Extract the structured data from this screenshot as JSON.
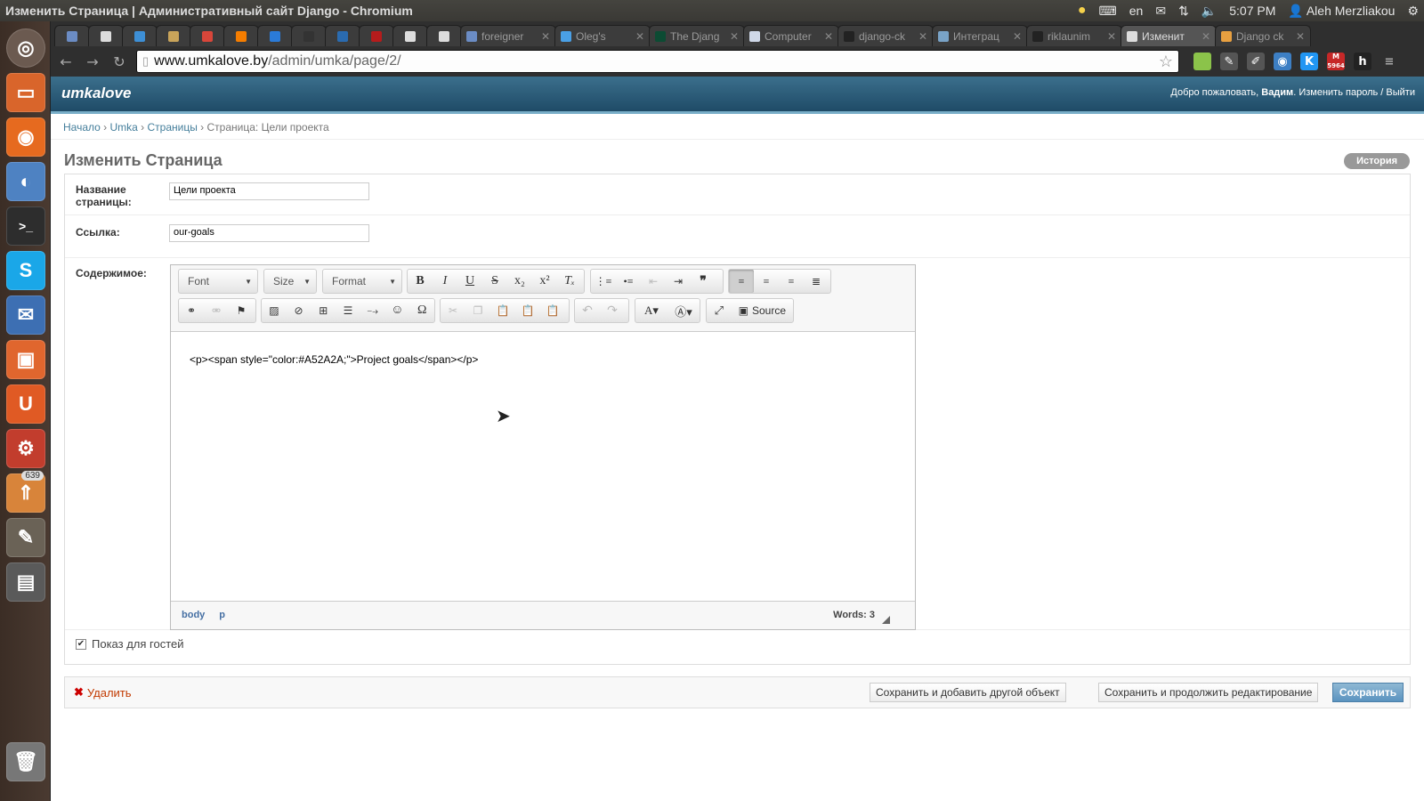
{
  "os": {
    "window_title": "Изменить Страница | Административный сайт Django - Chromium",
    "keyboard_layout": "en",
    "time": "5:07 PM",
    "user": "Aleh Merzliakou",
    "launcher_badge": "639"
  },
  "browser": {
    "tabs": [
      {
        "label": "foreigner",
        "active": false
      },
      {
        "label": "Oleg's",
        "active": false
      },
      {
        "label": "The Djang",
        "active": false
      },
      {
        "label": "Computer",
        "active": false
      },
      {
        "label": "django-ck",
        "active": false
      },
      {
        "label": "Интеграц",
        "active": false
      },
      {
        "label": "riklaunim",
        "active": false
      },
      {
        "label": "Изменит",
        "active": true
      },
      {
        "label": "Django ck",
        "active": false
      }
    ],
    "url_host": "www.umkalove.by",
    "url_path": "/admin/umka/page/2/",
    "ext_badge": "5964"
  },
  "admin": {
    "brand": "umkalove",
    "welcome": "Добро пожаловать,",
    "username": "Вадим",
    "change_password": "Изменить пароль",
    "separator": "/",
    "logout": "Выйти",
    "breadcrumb": {
      "home": "Начало",
      "app": "Umka",
      "model": "Страницы",
      "current": "Страница: Цели проекта"
    },
    "page_title": "Изменить Страница",
    "history_button": "История"
  },
  "form": {
    "title_label": "Название страницы:",
    "title_value": "Цели проекта",
    "slug_label": "Ссылка:",
    "slug_value": "our-goals",
    "content_label": "Содержимое:",
    "show_for_guests": "Показ для гостей",
    "show_for_guests_checked": true
  },
  "editor": {
    "font_combo": "Font",
    "size_combo": "Size",
    "format_combo": "Format",
    "source_button": "Source",
    "content_source": "<p><span style=\"color:#A52A2A;\">Project goals</span></p>",
    "path_body": "body",
    "path_p": "p",
    "word_count": "Words: 3"
  },
  "submit": {
    "delete": "Удалить",
    "save_add_another": "Сохранить и добавить другой объект",
    "save_continue": "Сохранить и продолжить редактирование",
    "save": "Сохранить"
  },
  "colors": {
    "header_bg": "#2b5a78",
    "link": "#447e9b",
    "delete": "#c23a00",
    "save_button": "#5a93c0"
  }
}
